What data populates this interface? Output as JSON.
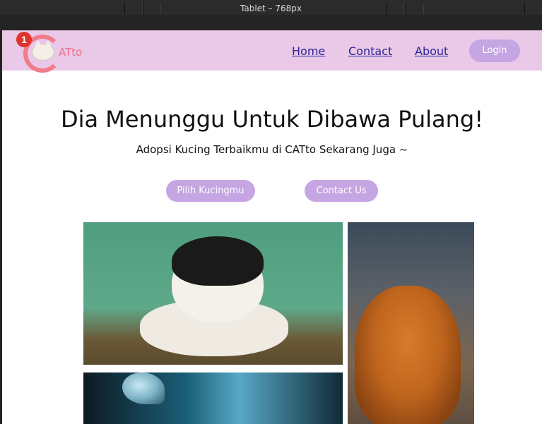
{
  "device": {
    "label": "Tablet – 768px"
  },
  "nav": {
    "badge_count": "1",
    "logo_text": "ATto",
    "links": [
      "Home",
      "Contact",
      "About"
    ],
    "login_label": "Login"
  },
  "hero": {
    "title": "Dia Menunggu Untuk Dibawa Pulang!",
    "subtitle": "Adopsi Kucing Terbaikmu di CATto Sekarang Juga ~",
    "buttons": [
      "Pilih Kucingmu",
      "Contact Us"
    ]
  },
  "colors": {
    "navbar_bg": "#e9c8e8",
    "button_bg": "#c5a6e2",
    "link": "#2a2496",
    "logo": "#ef6f85",
    "badge": "#e0332e"
  },
  "gallery": [
    {
      "alt": "black-and-white cat on wooden rail"
    },
    {
      "alt": "ginger kitten looking up"
    },
    {
      "alt": "cat with butterfly"
    }
  ]
}
